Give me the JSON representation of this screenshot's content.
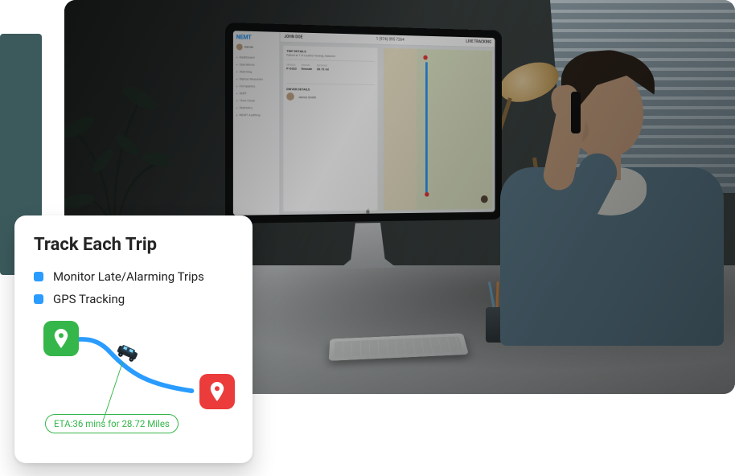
{
  "teal_accent": "#3c5a5c",
  "screen": {
    "logo_prefix": "N",
    "logo_suffix": "EMT",
    "nav": [
      "Dashboard",
      "Operations",
      "Alarming",
      "Signup Requests",
      "Companies",
      "Staff",
      "Time Clock",
      "Statistics",
      "NEMT Auditing"
    ],
    "header_left": "JOHN DOE",
    "header_phone": "1 (974) 095 7264",
    "header_right": "LIVE TRACKING",
    "section_trip": "TRIP DETAILS",
    "section_trip_sub": "Patient at 115 Louetta Freeway, Alabama",
    "section_driver": "DRIVER DETAILS",
    "driver_name": "James Smith"
  },
  "card": {
    "title": "Track Each Trip",
    "bullets": [
      "Monitor Late/Alarming Trips",
      "GPS Tracking"
    ],
    "eta": "ETA:36 mins for 28.72 Miles"
  },
  "colors": {
    "blue": "#2a9cff",
    "green": "#35b64a",
    "red": "#eb3b3b"
  }
}
